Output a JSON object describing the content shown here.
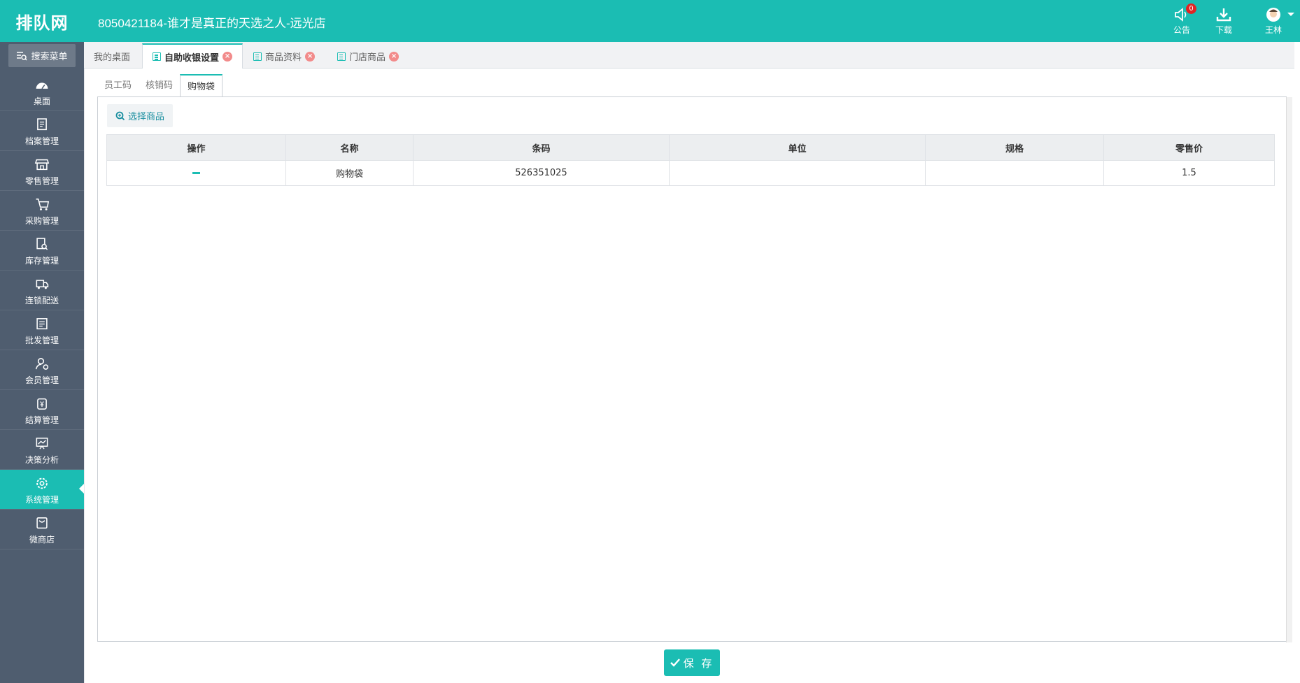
{
  "header": {
    "logo": "排队网",
    "shop_title": "8050421184-谁才是真正的天选之人-远光店",
    "notice_label": "公告",
    "notice_count": "0",
    "download_label": "下载",
    "user_name": "王林"
  },
  "sidebar": {
    "search_label": "搜索菜单",
    "items": [
      {
        "label": "桌面",
        "icon": "dashboard-icon"
      },
      {
        "label": "档案管理",
        "icon": "archive-icon"
      },
      {
        "label": "零售管理",
        "icon": "store-icon"
      },
      {
        "label": "采购管理",
        "icon": "cart-icon"
      },
      {
        "label": "库存管理",
        "icon": "inventory-icon"
      },
      {
        "label": "连锁配送",
        "icon": "truck-icon"
      },
      {
        "label": "批发管理",
        "icon": "wholesale-icon"
      },
      {
        "label": "会员管理",
        "icon": "member-icon"
      },
      {
        "label": "结算管理",
        "icon": "settlement-icon"
      },
      {
        "label": "决策分析",
        "icon": "analysis-icon"
      },
      {
        "label": "系统管理",
        "icon": "gear-icon",
        "active": true
      },
      {
        "label": "微商店",
        "icon": "shop-bag-icon"
      }
    ]
  },
  "tabs": [
    {
      "label": "我的桌面"
    },
    {
      "label": "自助收银设置",
      "active": true
    },
    {
      "label": "商品资料"
    },
    {
      "label": "门店商品"
    }
  ],
  "subtabs": [
    "员工码",
    "核销码",
    "购物袋"
  ],
  "toolbar": {
    "pick_label": "选择商品"
  },
  "table": {
    "headers": [
      "操作",
      "名称",
      "条码",
      "单位",
      "规格",
      "零售价"
    ],
    "rows": [
      {
        "name": "购物袋",
        "barcode": "526351025",
        "unit": "",
        "spec": "",
        "price": "1.5"
      }
    ]
  },
  "footer": {
    "save_label": "保 存"
  },
  "colors": {
    "accent": "#1bbdb3",
    "sidebar": "#4f5d6f"
  }
}
